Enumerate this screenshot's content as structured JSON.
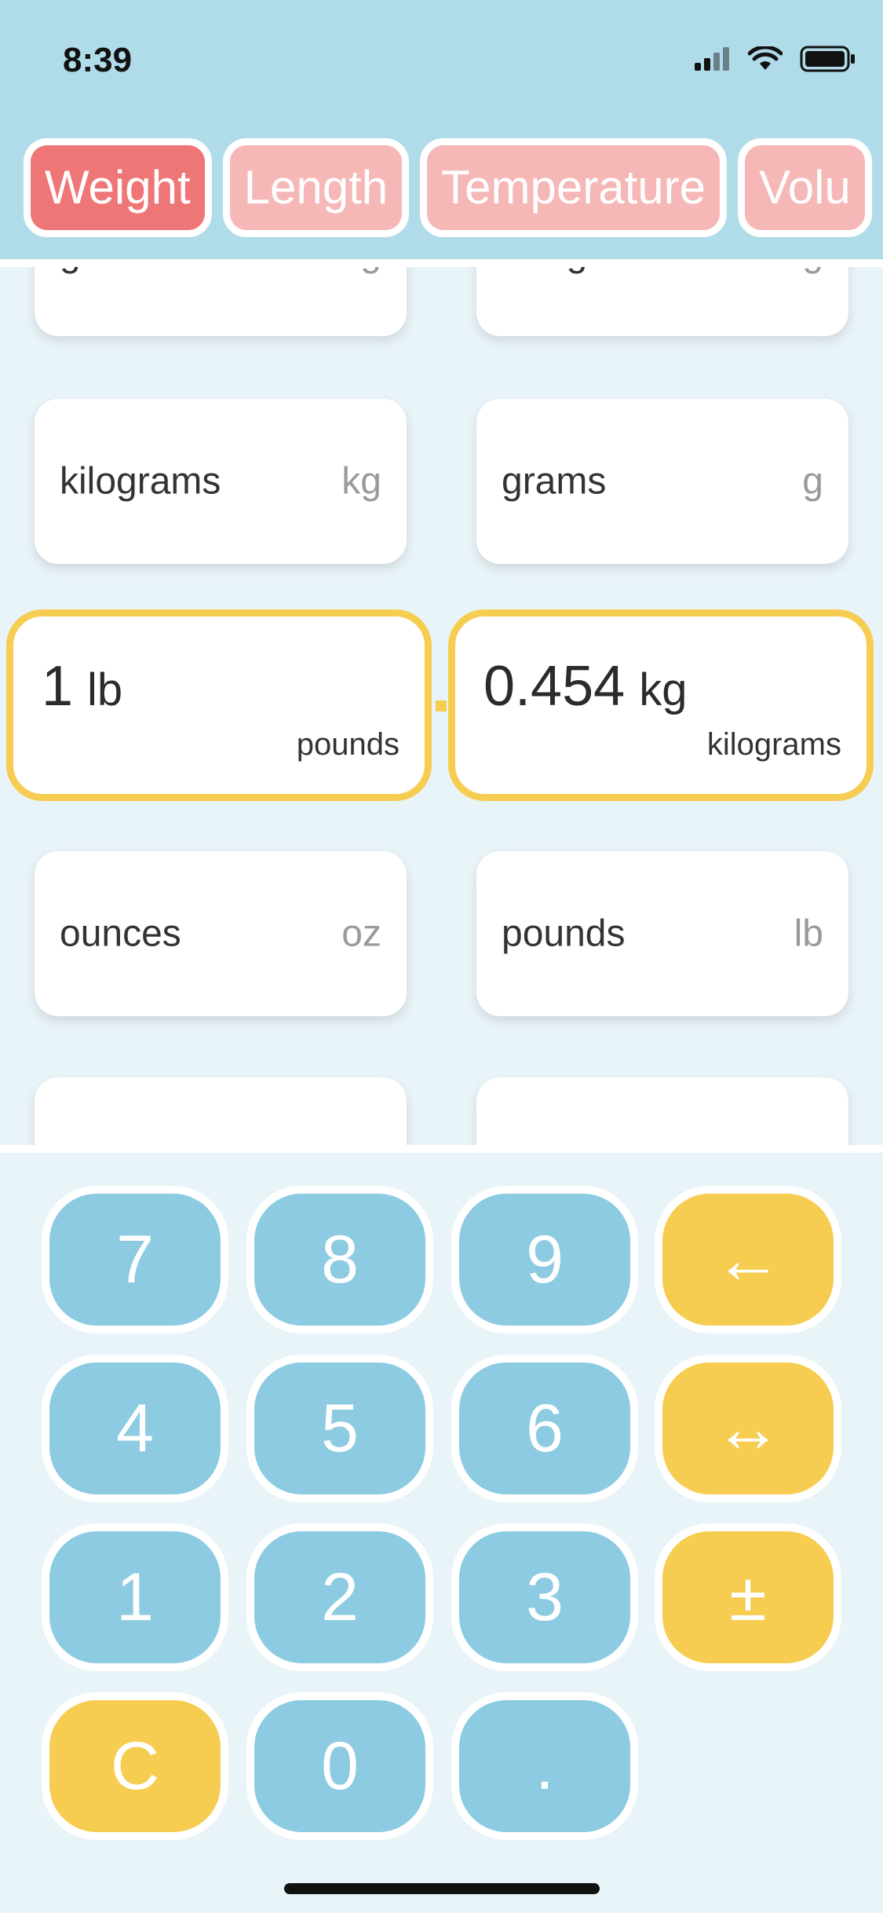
{
  "status_bar": {
    "time": "8:39"
  },
  "tabs": [
    {
      "label": "Weight",
      "active": true
    },
    {
      "label": "Length",
      "active": false
    },
    {
      "label": "Temperature",
      "active": false
    },
    {
      "label": "Volu",
      "active": false
    }
  ],
  "unit_cards": [
    {
      "name": "grams",
      "abbr": "g"
    },
    {
      "name": "milligrams",
      "abbr": "mg"
    },
    {
      "name": "kilograms",
      "abbr": "kg"
    },
    {
      "name": "grams",
      "abbr": "g"
    },
    {
      "name": "ounces",
      "abbr": "oz"
    },
    {
      "name": "pounds",
      "abbr": "lb"
    },
    {
      "name": "",
      "abbr": ""
    },
    {
      "name": "",
      "abbr": ""
    }
  ],
  "conversion": {
    "from": {
      "value": "1",
      "abbr": "lb",
      "name": "pounds"
    },
    "to": {
      "value": "0.454",
      "abbr": "kg",
      "name": "kilograms"
    }
  },
  "keypad": {
    "k7": "7",
    "k8": "8",
    "k9": "9",
    "backspace": "←",
    "k4": "4",
    "k5": "5",
    "k6": "6",
    "swap": "↔",
    "k1": "1",
    "k2": "2",
    "k3": "3",
    "sign": "±",
    "clear": "C",
    "k0": "0",
    "dot": "."
  },
  "colors": {
    "header_bg": "#b0dcea",
    "tab_active": "#ef7676",
    "tab_inactive": "#f6b7b7",
    "key_blue": "#8ccbe1",
    "key_yellow": "#f6cd50",
    "selection_border": "#f6cd50"
  }
}
